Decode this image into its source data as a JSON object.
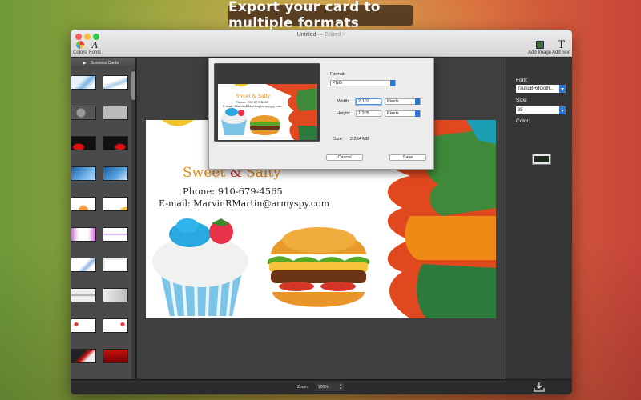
{
  "headline": "Export your card to multiple formats",
  "window": {
    "title": "Untitled",
    "edited": "— Edited ˅"
  },
  "toolbar": {
    "colors_label": "Colors",
    "fonts_label": "Fonts",
    "add_image_label": "Add Image",
    "add_text_label": "Add Text"
  },
  "sidebar": {
    "header": "Business Cards"
  },
  "card": {
    "title_word1": "Sweet",
    "title_amp": "&",
    "title_word2": "Salty",
    "phone": "Phone: 910-679-4565",
    "email": "E-mail: MarvinRMartin@armyspy.com"
  },
  "mini_card": {
    "title": "Sweet & Salty",
    "phone": "Phone: 910-679-4565",
    "email": "E-mail: MarvinRMartin@armyspy.com"
  },
  "export_sheet": {
    "format_label": "Format:",
    "format_value": "PNG",
    "width_label": "Width:",
    "width_value": "2,102",
    "width_unit": "Pixels",
    "height_label": "Height:",
    "height_value": "1,205",
    "height_unit": "Pixels",
    "size_label": "Size:",
    "size_value": "2.264 MB",
    "cancel_label": "Cancel",
    "save_label": "Save"
  },
  "inspector": {
    "font_label": "Font:",
    "font_value": "TsukuBRdGoth...",
    "size_label": "Size:",
    "size_value": "35",
    "color_label": "Color:",
    "color_value": "#1d2a1d"
  },
  "bottombar": {
    "zoom_label": "Zoom:",
    "zoom_value": "100%",
    "export_icon": "export-download-icon"
  },
  "colors": {
    "accent": "#2a76d9",
    "headline_bg": "#5a3f22",
    "title_orange": "#e58c1a",
    "title_red": "#d42c2c"
  }
}
